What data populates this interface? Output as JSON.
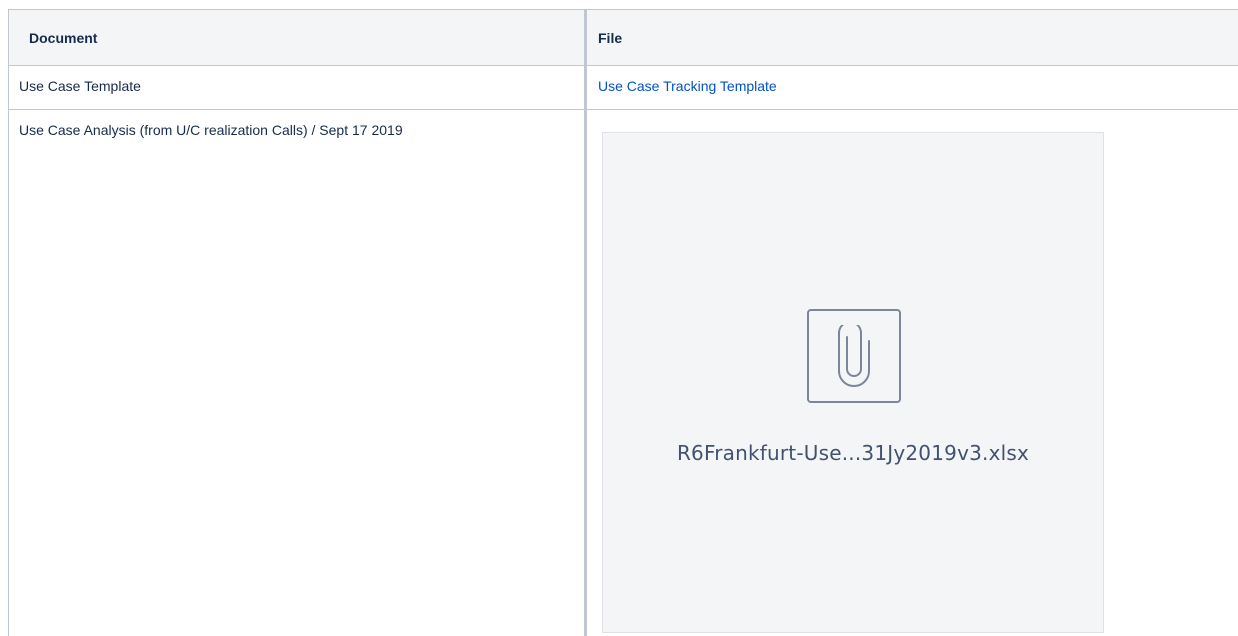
{
  "table": {
    "headers": {
      "document": "Document",
      "file": "File"
    },
    "rows": [
      {
        "document": "Use Case Template",
        "file_link": "Use Case Tracking Template"
      },
      {
        "document": "Use Case Analysis (from U/C realization Calls) / Sept 17 2019",
        "attachment": {
          "icon": "paperclip-icon",
          "file_name": "R6Frankfurt-Use...31Jy2019v3.xlsx"
        }
      }
    ]
  },
  "colors": {
    "link": "#0052cc",
    "header_bg": "#f4f5f7",
    "border": "#c1c7d0",
    "card_bg": "#f4f5f7"
  }
}
